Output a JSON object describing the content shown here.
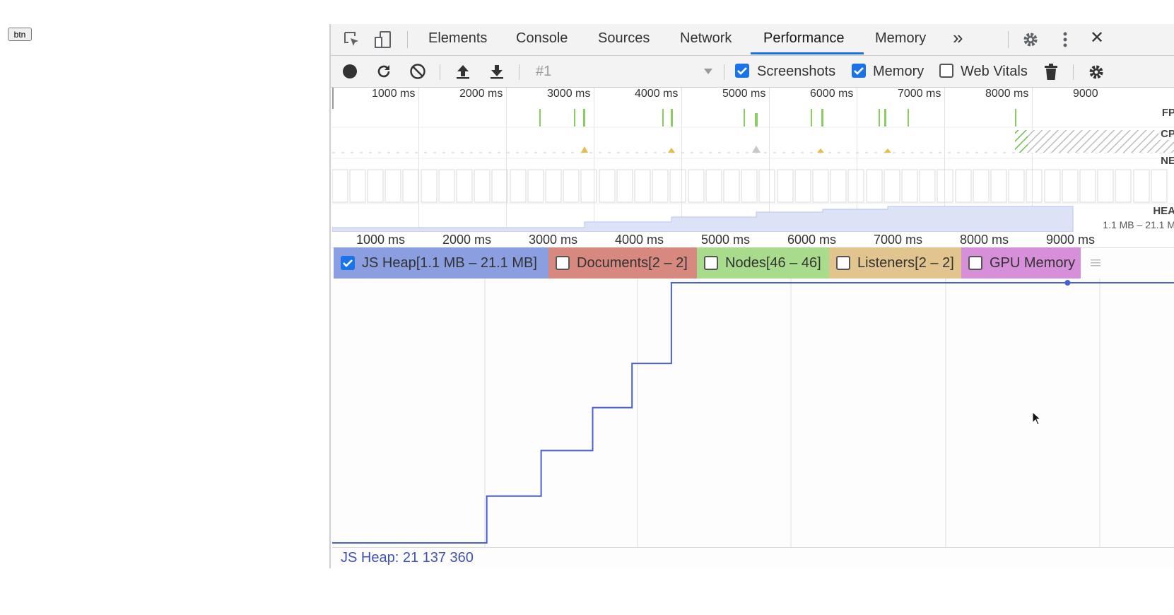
{
  "page": {
    "button_label": "btn"
  },
  "devtools": {
    "tabs": [
      {
        "label": "Elements",
        "active": false
      },
      {
        "label": "Console",
        "active": false
      },
      {
        "label": "Sources",
        "active": false
      },
      {
        "label": "Network",
        "active": false
      },
      {
        "label": "Performance",
        "active": true
      },
      {
        "label": "Memory",
        "active": false
      }
    ],
    "more_tabs_glyph": "»",
    "close_glyph": "✕",
    "toolbar": {
      "recording_select": "#1",
      "screenshots_label": "Screenshots",
      "screenshots_checked": true,
      "memory_label": "Memory",
      "memory_checked": true,
      "web_vitals_label": "Web Vitals",
      "web_vitals_checked": false
    },
    "overview": {
      "ticks": [
        "1000 ms",
        "2000 ms",
        "3000 ms",
        "4000 ms",
        "5000 ms",
        "6000 ms",
        "7000 ms",
        "8000 ms",
        "9000"
      ],
      "rows": {
        "fps": "FP",
        "cpu": "CP",
        "net": "NE",
        "heap": "HEA",
        "heap_range": "1.1 MB – 21.1 M"
      }
    },
    "ruler_ticks": [
      "1000 ms",
      "2000 ms",
      "3000 ms",
      "4000 ms",
      "5000 ms",
      "6000 ms",
      "7000 ms",
      "8000 ms",
      "9000 ms"
    ],
    "counters": [
      {
        "label": "JS Heap[1.1 MB – 21.1 MB]",
        "checked": true,
        "color": "#8a9ee0"
      },
      {
        "label": "Documents[2 – 2]",
        "checked": false,
        "color": "#d8897f"
      },
      {
        "label": "Nodes[46 – 46]",
        "checked": false,
        "color": "#a8dc8c"
      },
      {
        "label": "Listeners[2 – 2]",
        "checked": false,
        "color": "#e2c48e"
      },
      {
        "label": "GPU Memory",
        "checked": false,
        "color": "#d68fd8"
      }
    ],
    "footer": {
      "heap_readout": "JS Heap: 21 137 360"
    }
  },
  "colors": {
    "accent": "#1a73e8",
    "heap_line": "#4a5fd6",
    "fps_bar": "#8bcb62",
    "cpu_scripting": "#e4be4d"
  },
  "chart_data": {
    "type": "line",
    "series": [
      {
        "name": "JS Heap",
        "points_ms_mb": [
          [
            0,
            1.1
          ],
          [
            1650,
            1.1
          ],
          [
            1650,
            4.7
          ],
          [
            2230,
            4.7
          ],
          [
            2230,
            8.2
          ],
          [
            2780,
            8.2
          ],
          [
            2780,
            11.5
          ],
          [
            3200,
            11.5
          ],
          [
            3200,
            14.9
          ],
          [
            3620,
            14.9
          ],
          [
            3620,
            21.1
          ],
          [
            9000,
            21.1
          ]
        ]
      }
    ],
    "ylim": [
      1.1,
      21.1
    ],
    "xlim_ms": [
      0,
      9000
    ]
  }
}
